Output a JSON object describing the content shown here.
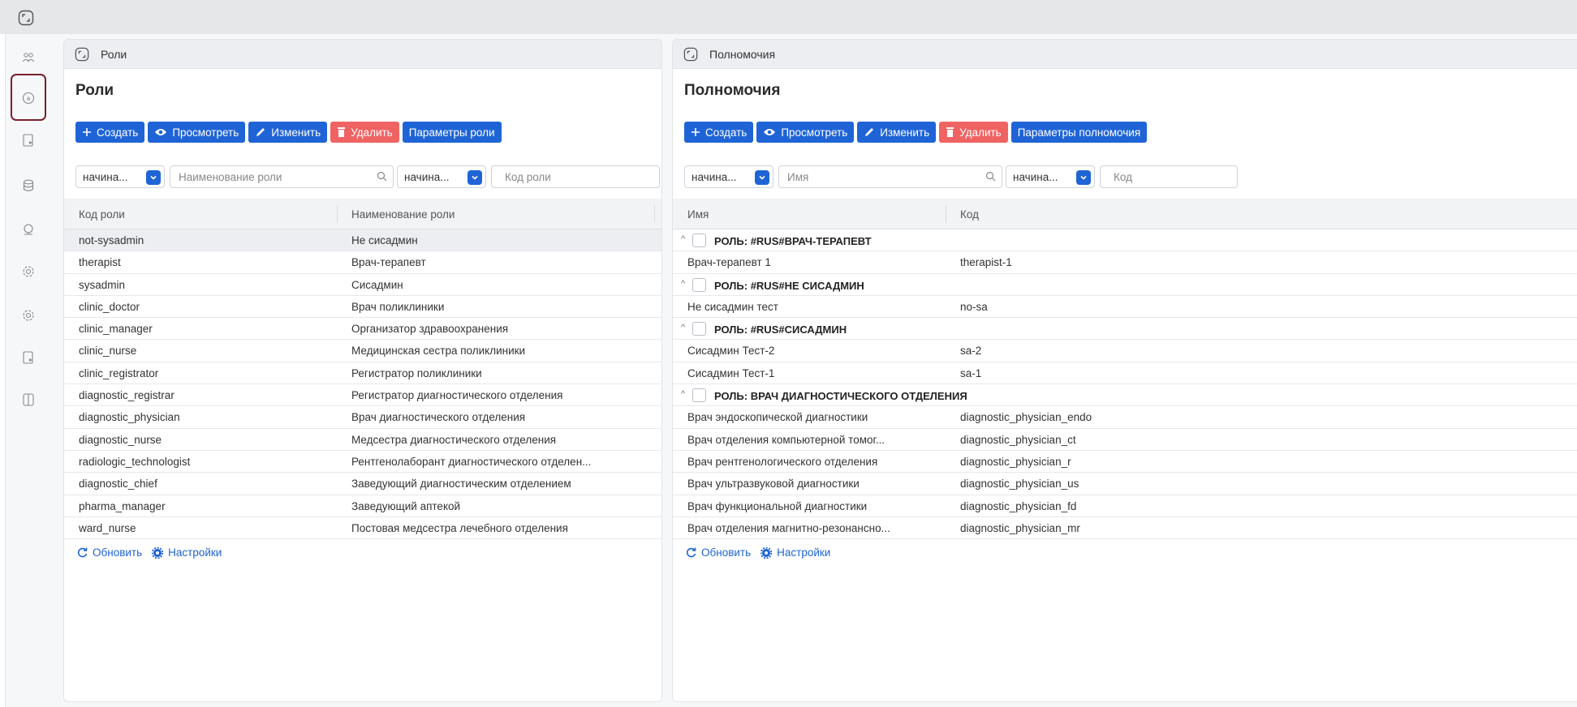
{
  "colors": {
    "primary": "#1f64d6",
    "danger": "#f06363",
    "rail_selected": "#7b1e2b"
  },
  "rail": {
    "icons": [
      "users-icon",
      "role-badge-icon",
      "document-play-icon",
      "database-icon",
      "network-icon",
      "settings-icon",
      "settings-alt-icon",
      "document-play-icon",
      "book-icon"
    ]
  },
  "roles": {
    "header_title": "Роли",
    "title": "Роли",
    "toolbar": {
      "create": "Создать",
      "view": "Просмотреть",
      "edit": "Изменить",
      "delete": "Удалить",
      "params": "Параметры роли"
    },
    "filters": {
      "mode1": "начина...",
      "name_placeholder": "Наименование роли",
      "mode2": "начина...",
      "code_placeholder": "Код роли"
    },
    "columns": {
      "code": "Код роли",
      "name": "Наименование роли"
    },
    "rows": [
      {
        "code": "not-sysadmin",
        "name": "Не сисадмин"
      },
      {
        "code": "therapist",
        "name": "Врач-терапевт"
      },
      {
        "code": "sysadmin",
        "name": "Сисадмин"
      },
      {
        "code": "clinic_doctor",
        "name": "Врач поликлиники"
      },
      {
        "code": "clinic_manager",
        "name": "Организатор здравоохранения"
      },
      {
        "code": "clinic_nurse",
        "name": "Медицинская сестра поликлиники"
      },
      {
        "code": "clinic_registrator",
        "name": "Регистратор поликлиники"
      },
      {
        "code": "diagnostic_registrar",
        "name": "Регистратор диагностического отделения"
      },
      {
        "code": "diagnostic_physician",
        "name": "Врач диагностического отделения"
      },
      {
        "code": "diagnostic_nurse",
        "name": "Медсестра диагностического отделения"
      },
      {
        "code": "radiologic_technologist",
        "name": "Рентгенолаборант диагностического отделен..."
      },
      {
        "code": "diagnostic_chief",
        "name": "Заведующий диагностическим отделением"
      },
      {
        "code": "pharma_manager",
        "name": "Заведующий аптекой"
      },
      {
        "code": "ward_nurse",
        "name": "Постовая медсестра лечебного отделения"
      }
    ],
    "footer": {
      "refresh": "Обновить",
      "settings": "Настройки"
    }
  },
  "perms": {
    "header_title": "Полномочия",
    "title": "Полномочия",
    "toolbar": {
      "create": "Создать",
      "view": "Просмотреть",
      "edit": "Изменить",
      "delete": "Удалить",
      "params": "Параметры полномочия"
    },
    "filters": {
      "mode1": "начина...",
      "name_placeholder": "Имя",
      "mode2": "начина...",
      "code_placeholder": "Код"
    },
    "columns": {
      "name": "Имя",
      "code": "Код"
    },
    "groups": [
      {
        "label": "РОЛЬ: #RUS#ВРАЧ-ТЕРАПЕВТ",
        "rows": [
          {
            "name": "Врач-терапевт 1",
            "code": "therapist-1"
          }
        ]
      },
      {
        "label": "РОЛЬ: #RUS#НЕ СИСАДМИН",
        "rows": [
          {
            "name": "Не сисадмин тест",
            "code": "no-sa"
          }
        ]
      },
      {
        "label": "РОЛЬ: #RUS#СИСАДМИН",
        "rows": [
          {
            "name": "Сисадмин Тест-2",
            "code": "sa-2"
          },
          {
            "name": "Сисадмин Тест-1",
            "code": "sa-1"
          }
        ]
      },
      {
        "label": "РОЛЬ: ВРАЧ ДИАГНОСТИЧЕСКОГО ОТДЕЛЕНИЯ",
        "rows": [
          {
            "name": "Врач эндоскопической диагностики",
            "code": "diagnostic_physician_endo"
          },
          {
            "name": "Врач отделения компьютерной томог...",
            "code": "diagnostic_physician_ct"
          },
          {
            "name": "Врач рентгенологического отделения",
            "code": "diagnostic_physician_r"
          },
          {
            "name": "Врач ультразвуковой диагностики",
            "code": "diagnostic_physician_us"
          },
          {
            "name": "Врач функциональной диагностики",
            "code": "diagnostic_physician_fd"
          },
          {
            "name": "Врач отделения магнитно-резонансно...",
            "code": "diagnostic_physician_mr"
          }
        ]
      }
    ],
    "footer": {
      "refresh": "Обновить",
      "settings": "Настройки"
    }
  }
}
